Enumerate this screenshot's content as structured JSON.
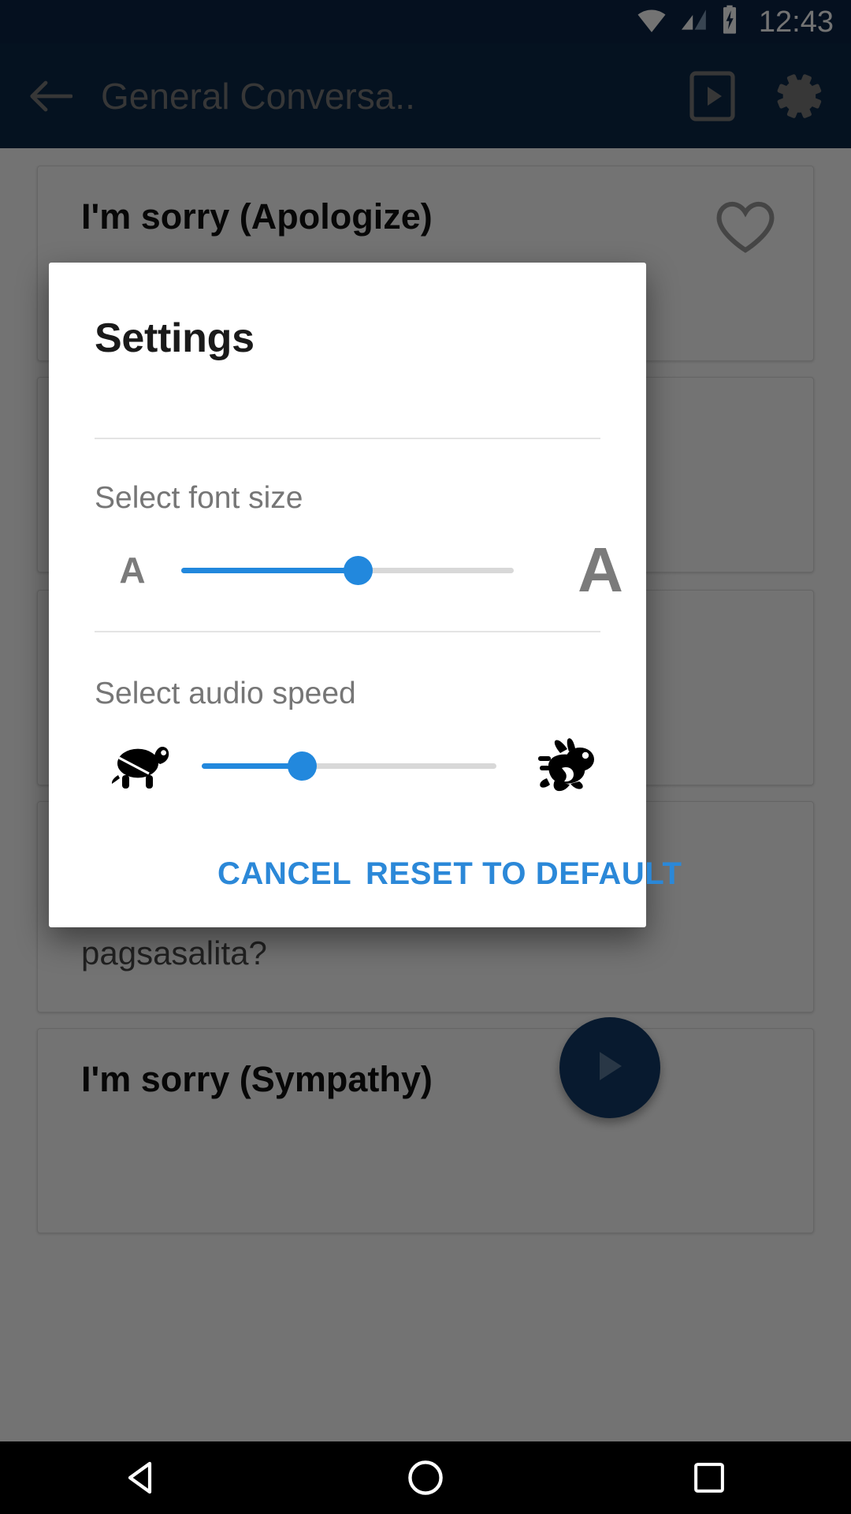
{
  "status_bar": {
    "time": "12:43",
    "icons": [
      "wifi-icon",
      "signal-icon",
      "battery-charging-icon"
    ]
  },
  "app_bar": {
    "back_icon": "back-arrow-icon",
    "title": "General Conversa..",
    "phone_play_icon": "device-play-icon",
    "settings_icon": "gear-icon"
  },
  "content": {
    "cards": [
      {
        "title": "I'm sorry (Apologize)",
        "body": "",
        "favorite_icon": "heart-outline-icon"
      },
      {
        "title": "",
        "body": "pagsasalita?",
        "favorite_icon": ""
      },
      {
        "title": "I'm sorry (Sympathy)",
        "body": "",
        "favorite_icon": ""
      }
    ],
    "fab_icon": "play-icon"
  },
  "dialog": {
    "title": "Settings",
    "font_size": {
      "label": "Select font size",
      "small_glyph": "A",
      "large_glyph": "A",
      "value_percent": 53,
      "min": 0,
      "max": 100
    },
    "audio_speed": {
      "label": "Select audio speed",
      "slow_icon": "turtle-icon",
      "fast_icon": "rabbit-icon",
      "value_percent": 34,
      "min": 0,
      "max": 100
    },
    "actions": {
      "cancel_label": "CANCEL",
      "reset_label": "RESET TO DEFAULT"
    }
  },
  "nav_bar": {
    "back_label": "back-triangle-icon",
    "home_label": "home-circle-icon",
    "recents_label": "recents-square-icon"
  },
  "colors": {
    "status_bar_bg": "#0d2546",
    "app_bar_bg": "#123a68",
    "accent_blue": "#2288dd",
    "action_blue": "#2b88d8",
    "track_gray": "#d8d8d8",
    "label_gray": "#767676"
  }
}
